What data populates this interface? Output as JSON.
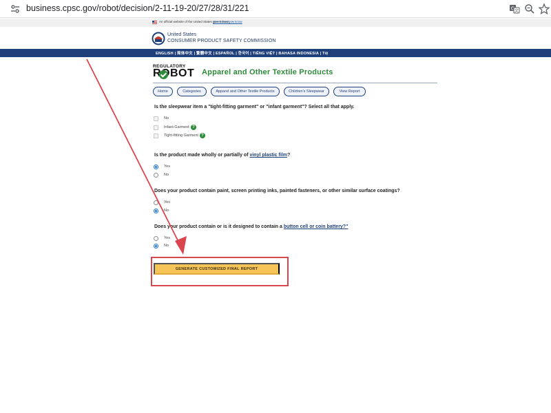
{
  "browser": {
    "url": "business.cpsc.gov/robot/decision/2-11-19-20/27/28/31/221",
    "icons": [
      "site-info-icon",
      "translate-icon",
      "zoom-icon",
      "bookmark-star-icon"
    ]
  },
  "gov_banner": {
    "text": "An official website of the United States government",
    "link": "Here's how you know",
    "chevron": "⌄"
  },
  "agency": {
    "line1": "United States",
    "line2": "CONSUMER PRODUCT SAFETY COMMISSION"
  },
  "language_nav": {
    "text": "ENGLISH | 简体中文 | 繁體中文 | ESPAÑOL | 한국어 | TIẾNG VIỆT | BAHASA INDONESIA | Tiệ"
  },
  "robot": {
    "logo_top": "REGULATORY",
    "logo_bottom": "ROBOT",
    "title": "Apparel and Other Textile Products"
  },
  "breadcrumbs": [
    "Home",
    "Categories",
    "Apparel and Other Textile Products",
    "Children's Sleepwear",
    "View Report"
  ],
  "questions": [
    {
      "text": "Is the sleepwear item a \"tight-fitting garment\" or \"infant garment\"? Select all that apply.",
      "options": [
        {
          "label": "No",
          "type": "checkbox",
          "checked": false
        },
        {
          "label": "Infant Garment",
          "type": "checkbox",
          "checked": false,
          "help": "?"
        },
        {
          "label": "Tight-fitting Garment",
          "type": "checkbox",
          "checked": false,
          "help": "?"
        }
      ]
    },
    {
      "text_before": "Is the product made wholly or partially of ",
      "link": "vinyl plastic film",
      "text_after": "?",
      "options": [
        {
          "label": "Yes",
          "type": "radio",
          "checked": true
        },
        {
          "label": "No",
          "type": "radio",
          "checked": false
        }
      ]
    },
    {
      "text": "Does your product contain paint, screen printing inks, painted fasteners, or other similar surface coatings?",
      "options": [
        {
          "label": "Yes",
          "type": "radio",
          "checked": false
        },
        {
          "label": "No",
          "type": "radio",
          "checked": true
        }
      ]
    },
    {
      "text_before": "Does your product contain or is it designed to contain a ",
      "link": "button cell or coin battery?\"",
      "text_after": "",
      "options": [
        {
          "label": "Yes",
          "type": "radio",
          "checked": false
        },
        {
          "label": "No",
          "type": "radio",
          "checked": true
        }
      ]
    }
  ],
  "generate_button": {
    "label": "GENERATE CUSTOMIZED FINAL REPORT"
  },
  "colors": {
    "nav_blue": "#1f3f7a",
    "brand_green": "#2e8b3a",
    "button_yellow": "#f7c457",
    "annotation_red": "#d9464e"
  }
}
